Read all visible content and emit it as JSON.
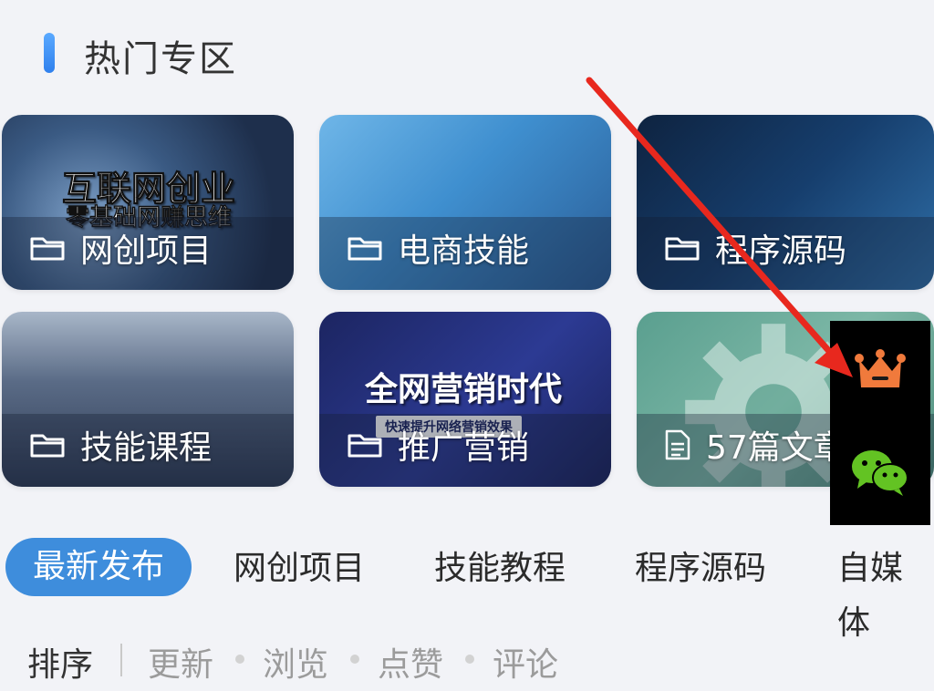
{
  "section": {
    "title": "热门专区"
  },
  "cards": [
    {
      "label": "网创项目",
      "banner_main": "互联网创业",
      "banner_sub": "零基础网赚思维"
    },
    {
      "label": "电商技能"
    },
    {
      "label": "程序源码"
    },
    {
      "label": "技能课程"
    },
    {
      "label": "推广营销",
      "banner_main": "全网营销时代",
      "banner_sub": "快速提升网络营销效果"
    },
    {
      "label": "57篇文章"
    }
  ],
  "tabs": [
    "最新发布",
    "网创项目",
    "技能教程",
    "程序源码",
    "自媒体"
  ],
  "sort": {
    "label": "排序",
    "options": [
      "更新",
      "浏览",
      "点赞",
      "评论"
    ]
  },
  "colors": {
    "accent": "#3e8ddc",
    "vip": "#f07a3c",
    "wechat": "#63c323",
    "arrow": "#e8281e"
  },
  "floating": {
    "vip_icon": "crown-icon",
    "wechat_icon": "wechat-icon"
  }
}
